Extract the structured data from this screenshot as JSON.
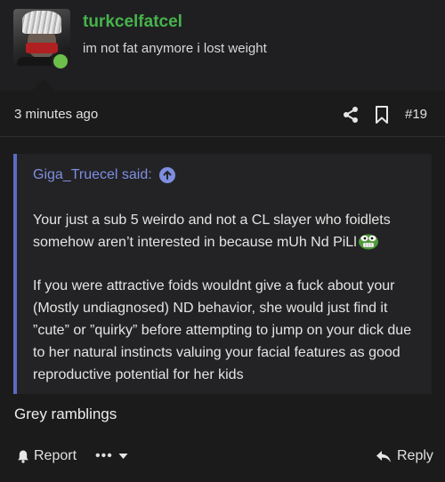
{
  "user": {
    "username": "turkcelfatcel",
    "title": "im not fat anymore i lost weight",
    "online": true,
    "username_color": "#47b34b"
  },
  "meta": {
    "timestamp": "3 minutes ago",
    "post_number": "#19",
    "icons": [
      "share-icon",
      "bookmark-icon"
    ]
  },
  "quote": {
    "author_line": "Giga_Truecel said:",
    "paragraph_1": "Your just a sub 5 weirdo and not a CL slayer who foidlets somehow aren’t interested in because mUh Nd PiLl",
    "paragraph_2": "If you were attractive foids wouldnt give a fuck about your (Mostly undiagnosed) ND behavior, she would just find it ”cute” or ”quirky” before attempting to jump on your dick due to her natural instincts valuing your facial features as good reproductive potential for her kids",
    "accent_color": "#5c6bc0"
  },
  "message": {
    "body": "Grey ramblings"
  },
  "actions": {
    "report_label": "Report",
    "more_label": "•••",
    "reply_label": "Reply"
  }
}
